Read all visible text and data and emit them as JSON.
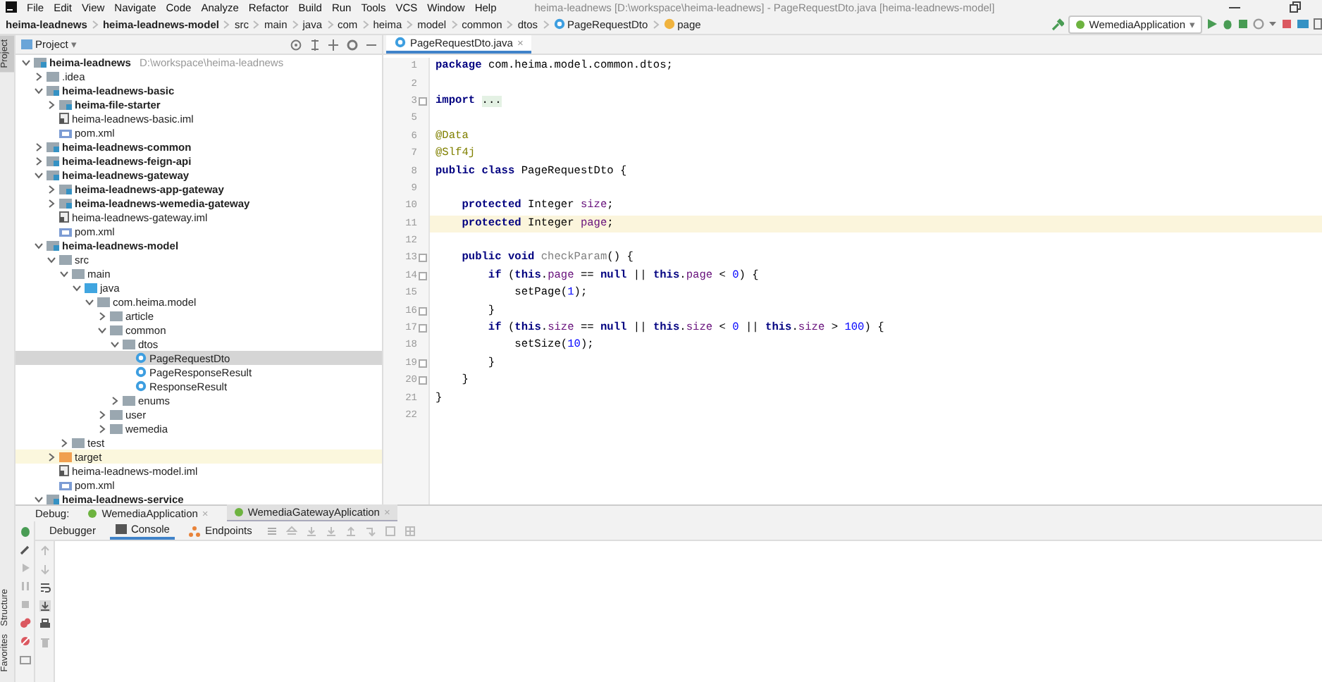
{
  "menu": {
    "items": [
      "File",
      "Edit",
      "View",
      "Navigate",
      "Code",
      "Analyze",
      "Refactor",
      "Build",
      "Run",
      "Tools",
      "VCS",
      "Window",
      "Help"
    ],
    "title": "heima-leadnews [D:\\workspace\\heima-leadnews] - PageRequestDto.java [heima-leadnews-model]"
  },
  "breadcrumbs": [
    {
      "label": "heima-leadnews",
      "kind": "module"
    },
    {
      "label": "heima-leadnews-model",
      "kind": "module"
    },
    {
      "label": "src",
      "kind": "folder"
    },
    {
      "label": "main",
      "kind": "folder"
    },
    {
      "label": "java",
      "kind": "folder"
    },
    {
      "label": "com",
      "kind": "folder"
    },
    {
      "label": "heima",
      "kind": "folder"
    },
    {
      "label": "model",
      "kind": "folder"
    },
    {
      "label": "common",
      "kind": "folder"
    },
    {
      "label": "dtos",
      "kind": "folder"
    },
    {
      "label": "PageRequestDto",
      "kind": "class"
    },
    {
      "label": "page",
      "kind": "field"
    }
  ],
  "run_config": {
    "label": "WemediaApplication",
    "arrow": "▾"
  },
  "side_tabs": {
    "top": "Project",
    "bottom": [
      "Structure",
      "Favorites"
    ]
  },
  "project": {
    "title": "Project",
    "arrow": "▾",
    "tree": [
      {
        "label": "heima-leadnews",
        "hint": "D:\\workspace\\heima-leadnews",
        "kind": "module",
        "expanded": true,
        "selected": false,
        "highlighted": false,
        "children": [
          {
            "label": ".idea",
            "kind": "folder",
            "expanded": false,
            "selected": false,
            "highlighted": false
          },
          {
            "label": "heima-leadnews-basic",
            "kind": "module",
            "expanded": true,
            "selected": false,
            "highlighted": false,
            "children": [
              {
                "label": "heima-file-starter",
                "kind": "module",
                "expanded": false,
                "selected": false,
                "highlighted": false
              },
              {
                "label": "heima-leadnews-basic.iml",
                "kind": "iml",
                "selected": false,
                "highlighted": false
              },
              {
                "label": "pom.xml",
                "kind": "pom",
                "selected": false,
                "highlighted": false
              }
            ]
          },
          {
            "label": "heima-leadnews-common",
            "kind": "module",
            "expanded": false,
            "selected": false,
            "highlighted": false
          },
          {
            "label": "heima-leadnews-feign-api",
            "kind": "module",
            "expanded": false,
            "selected": false,
            "highlighted": false
          },
          {
            "label": "heima-leadnews-gateway",
            "kind": "module",
            "expanded": true,
            "selected": false,
            "highlighted": false,
            "children": [
              {
                "label": "heima-leadnews-app-gateway",
                "kind": "module",
                "expanded": false,
                "selected": false,
                "highlighted": false
              },
              {
                "label": "heima-leadnews-wemedia-gateway",
                "kind": "module",
                "expanded": false,
                "selected": false,
                "highlighted": false
              },
              {
                "label": "heima-leadnews-gateway.iml",
                "kind": "iml",
                "selected": false,
                "highlighted": false
              },
              {
                "label": "pom.xml",
                "kind": "pom",
                "selected": false,
                "highlighted": false
              }
            ]
          },
          {
            "label": "heima-leadnews-model",
            "kind": "module",
            "expanded": true,
            "selected": false,
            "highlighted": false,
            "children": [
              {
                "label": "src",
                "kind": "folder",
                "expanded": true,
                "selected": false,
                "highlighted": false,
                "children": [
                  {
                    "label": "main",
                    "kind": "folder",
                    "expanded": true,
                    "selected": false,
                    "highlighted": false,
                    "children": [
                      {
                        "label": "java",
                        "kind": "source",
                        "expanded": true,
                        "selected": false,
                        "highlighted": false,
                        "children": [
                          {
                            "label": "com.heima.model",
                            "kind": "folder",
                            "expanded": true,
                            "selected": false,
                            "highlighted": false,
                            "children": [
                              {
                                "label": "article",
                                "kind": "folder",
                                "expanded": false,
                                "selected": false,
                                "highlighted": false
                              },
                              {
                                "label": "common",
                                "kind": "folder",
                                "expanded": true,
                                "selected": false,
                                "highlighted": false,
                                "children": [
                                  {
                                    "label": "dtos",
                                    "kind": "folder",
                                    "expanded": true,
                                    "selected": false,
                                    "highlighted": false,
                                    "children": [
                                      {
                                        "label": "PageRequestDto",
                                        "kind": "class",
                                        "selected": true,
                                        "highlighted": false
                                      },
                                      {
                                        "label": "PageResponseResult",
                                        "kind": "class",
                                        "selected": false,
                                        "highlighted": false
                                      },
                                      {
                                        "label": "ResponseResult",
                                        "kind": "class",
                                        "selected": false,
                                        "highlighted": false
                                      }
                                    ]
                                  },
                                  {
                                    "label": "enums",
                                    "kind": "folder",
                                    "expanded": false,
                                    "selected": false,
                                    "highlighted": false
                                  }
                                ]
                              },
                              {
                                "label": "user",
                                "kind": "folder",
                                "expanded": false,
                                "selected": false,
                                "highlighted": false
                              },
                              {
                                "label": "wemedia",
                                "kind": "folder",
                                "expanded": false,
                                "selected": false,
                                "highlighted": false
                              }
                            ]
                          }
                        ]
                      }
                    ]
                  },
                  {
                    "label": "test",
                    "kind": "folder",
                    "expanded": false,
                    "selected": false,
                    "highlighted": false
                  }
                ]
              },
              {
                "label": "target",
                "kind": "excluded",
                "expanded": false,
                "selected": false,
                "highlighted": true
              },
              {
                "label": "heima-leadnews-model.iml",
                "kind": "iml",
                "selected": false,
                "highlighted": false
              },
              {
                "label": "pom.xml",
                "kind": "pom",
                "selected": false,
                "highlighted": false
              }
            ]
          },
          {
            "label": "heima-leadnews-service",
            "kind": "module",
            "expanded": true,
            "selected": false,
            "highlighted": false
          }
        ]
      }
    ]
  },
  "editor": {
    "tab": {
      "label": "PageRequestDto.java",
      "close": "×"
    },
    "lines": [
      {
        "number": "1",
        "current": false,
        "fold_marker": false,
        "tokens": [
          {
            "kind": "keyword",
            "text": "package "
          },
          {
            "kind": "plain",
            "text": "com.heima.model.common.dtos;"
          }
        ]
      },
      {
        "number": "2",
        "current": false,
        "fold_marker": false
      },
      {
        "number": "3",
        "current": false,
        "fold_marker": true,
        "tokens": [
          {
            "kind": "keyword",
            "text": "import "
          },
          {
            "kind": "folded",
            "text": "..."
          }
        ]
      },
      {
        "number": "5",
        "current": false,
        "fold_marker": false
      },
      {
        "number": "6",
        "current": false,
        "fold_marker": false,
        "tokens": [
          {
            "kind": "annotation",
            "text": "@Data"
          }
        ]
      },
      {
        "number": "7",
        "current": false,
        "fold_marker": false,
        "tokens": [
          {
            "kind": "annotation",
            "text": "@Slf4j"
          }
        ]
      },
      {
        "number": "8",
        "current": false,
        "fold_marker": false,
        "tokens": [
          {
            "kind": "keyword",
            "text": "public class "
          },
          {
            "kind": "plain",
            "text": "PageRequestDto {"
          }
        ]
      },
      {
        "number": "9",
        "current": false,
        "fold_marker": false
      },
      {
        "number": "10",
        "current": false,
        "fold_marker": false,
        "tokens": [
          {
            "kind": "keyword",
            "text": "    protected "
          },
          {
            "kind": "plain",
            "text": "Integer "
          },
          {
            "kind": "field",
            "text": "size"
          },
          {
            "kind": "plain",
            "text": ";"
          }
        ]
      },
      {
        "number": "11",
        "current": true,
        "fold_marker": false,
        "tokens": [
          {
            "kind": "keyword",
            "text": "    protected "
          },
          {
            "kind": "plain",
            "text": "Integer "
          },
          {
            "kind": "field",
            "text": "page"
          },
          {
            "kind": "plain",
            "text": ";"
          }
        ]
      },
      {
        "number": "12",
        "current": false,
        "fold_marker": false
      },
      {
        "number": "13",
        "current": false,
        "fold_marker": true,
        "tokens": [
          {
            "kind": "keyword",
            "text": "    public void "
          },
          {
            "kind": "unused",
            "text": "checkParam"
          },
          {
            "kind": "plain",
            "text": "() {"
          }
        ]
      },
      {
        "number": "14",
        "current": false,
        "fold_marker": true,
        "tokens": [
          {
            "kind": "keyword",
            "text": "        if "
          },
          {
            "kind": "plain",
            "text": "("
          },
          {
            "kind": "keyword",
            "text": "this"
          },
          {
            "kind": "plain",
            "text": "."
          },
          {
            "kind": "field",
            "text": "page"
          },
          {
            "kind": "plain",
            "text": " == "
          },
          {
            "kind": "keyword",
            "text": "null"
          },
          {
            "kind": "plain",
            "text": " || "
          },
          {
            "kind": "keyword",
            "text": "this"
          },
          {
            "kind": "plain",
            "text": "."
          },
          {
            "kind": "field",
            "text": "page"
          },
          {
            "kind": "plain",
            "text": " < "
          },
          {
            "kind": "number",
            "text": "0"
          },
          {
            "kind": "plain",
            "text": ") {"
          }
        ]
      },
      {
        "number": "15",
        "current": false,
        "fold_marker": false,
        "tokens": [
          {
            "kind": "plain",
            "text": "            setPage("
          },
          {
            "kind": "number",
            "text": "1"
          },
          {
            "kind": "plain",
            "text": ");"
          }
        ]
      },
      {
        "number": "16",
        "current": false,
        "fold_marker": true,
        "tokens": [
          {
            "kind": "plain",
            "text": "        }"
          }
        ]
      },
      {
        "number": "17",
        "current": false,
        "fold_marker": true,
        "tokens": [
          {
            "kind": "keyword",
            "text": "        if "
          },
          {
            "kind": "plain",
            "text": "("
          },
          {
            "kind": "keyword",
            "text": "this"
          },
          {
            "kind": "plain",
            "text": "."
          },
          {
            "kind": "field",
            "text": "size"
          },
          {
            "kind": "plain",
            "text": " == "
          },
          {
            "kind": "keyword",
            "text": "null"
          },
          {
            "kind": "plain",
            "text": " || "
          },
          {
            "kind": "keyword",
            "text": "this"
          },
          {
            "kind": "plain",
            "text": "."
          },
          {
            "kind": "field",
            "text": "size"
          },
          {
            "kind": "plain",
            "text": " < "
          },
          {
            "kind": "number",
            "text": "0"
          },
          {
            "kind": "plain",
            "text": " || "
          },
          {
            "kind": "keyword",
            "text": "this"
          },
          {
            "kind": "plain",
            "text": "."
          },
          {
            "kind": "field",
            "text": "size"
          },
          {
            "kind": "plain",
            "text": " > "
          },
          {
            "kind": "number",
            "text": "100"
          },
          {
            "kind": "plain",
            "text": ") {"
          }
        ]
      },
      {
        "number": "18",
        "current": false,
        "fold_marker": false,
        "tokens": [
          {
            "kind": "plain",
            "text": "            setSize("
          },
          {
            "kind": "number",
            "text": "10"
          },
          {
            "kind": "plain",
            "text": ");"
          }
        ]
      },
      {
        "number": "19",
        "current": false,
        "fold_marker": true,
        "tokens": [
          {
            "kind": "plain",
            "text": "        }"
          }
        ]
      },
      {
        "number": "20",
        "current": false,
        "fold_marker": true,
        "tokens": [
          {
            "kind": "plain",
            "text": "    }"
          }
        ]
      },
      {
        "number": "21",
        "current": false,
        "fold_marker": false,
        "tokens": [
          {
            "kind": "plain",
            "text": "}"
          }
        ]
      },
      {
        "number": "22",
        "current": false,
        "fold_marker": false
      }
    ]
  },
  "debug": {
    "label": "Debug:",
    "tabs": [
      {
        "label": "WemediaApplication",
        "close": "×",
        "selected": false
      },
      {
        "label": "WemediaGatewayAplication",
        "close": "×",
        "selected": true
      }
    ],
    "subtabs": [
      {
        "label": "Debugger",
        "kind": "plain",
        "selected": false
      },
      {
        "label": "Console",
        "kind": "console",
        "selected": true
      },
      {
        "label": "Endpoints",
        "kind": "endpoints",
        "selected": false
      }
    ]
  }
}
